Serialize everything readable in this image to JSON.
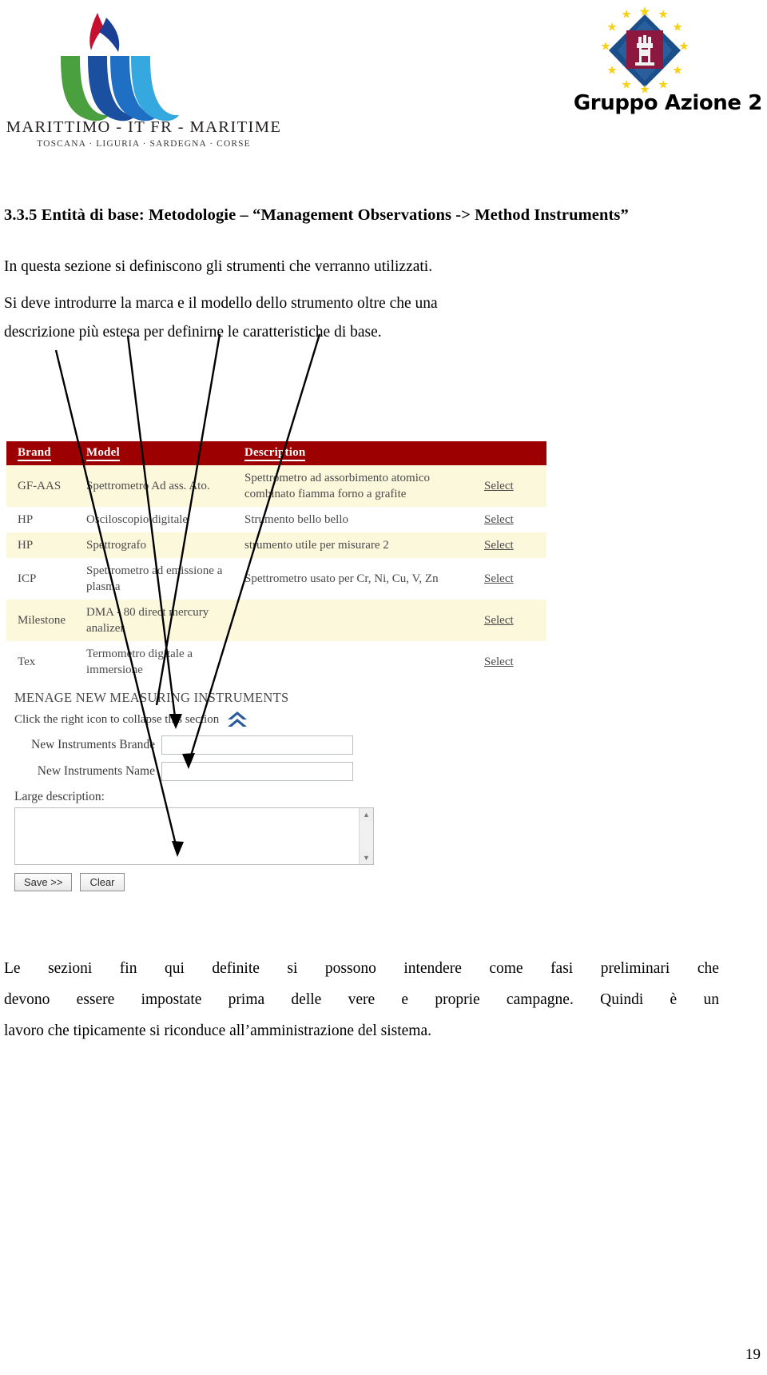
{
  "header": {
    "left_logo": {
      "wordmark": "MARITTIMO - IT FR - MARITIME",
      "subwordmark": "TOSCANA · LIGURIA · SARDEGNA · CORSE"
    },
    "right_logo": {
      "title": "Gruppo Azione 2"
    }
  },
  "document": {
    "section_number": "3.3.5",
    "heading": "3.3.5 Entità di base: Metodologie – “Management Observations -> Method Instruments”",
    "paragraph_1": "In questa sezione si definiscono gli strumenti che verranno utilizzati.",
    "paragraph_2_line_1": [
      "Si",
      "deve",
      "introdurre",
      "la",
      "marca",
      "e",
      "il",
      "modello",
      "dello",
      "strumento",
      "oltre",
      "che",
      "una"
    ],
    "paragraph_2_line_2": "descrizione più estesa per definirne le caratteristiche di base.",
    "paragraph_3_line_1": [
      "Le",
      "sezioni",
      "fin",
      "qui",
      "definite",
      "si",
      "possono",
      "intendere",
      "come",
      "fasi",
      "preliminari",
      "che"
    ],
    "paragraph_3_line_2": [
      "devono",
      "essere",
      "impostate",
      "prima",
      "delle",
      "vere",
      "e",
      "proprie",
      "campagne.",
      "Quindi",
      "è",
      "un"
    ],
    "paragraph_3_line_3": "lavoro che tipicamente si riconduce all’amministrazione del sistema.",
    "page_number": "19"
  },
  "screenshot": {
    "table": {
      "columns": [
        "Brand",
        "Model",
        "Description"
      ],
      "action_label": "Select",
      "rows": [
        {
          "brand": "GF-AAS",
          "model": "Spettrometro Ad ass. Ato.",
          "description": "Spettrometro ad assorbimento atomico combinato fiamma forno a grafite",
          "action": "Select"
        },
        {
          "brand": "HP",
          "model": "Osciloscopio digitale",
          "description": "Strumento bello bello",
          "action": "Select"
        },
        {
          "brand": "HP",
          "model": "Spettrografo",
          "description": "strumento utile per misurare 2",
          "action": "Select"
        },
        {
          "brand": "ICP",
          "model": "Spettrometro ad emissione a plasma",
          "description": "Spettrometro usato per Cr, Ni, Cu, V, Zn",
          "action": "Select"
        },
        {
          "brand": "Milestone",
          "model": "DMA - 80 direct mercury analizer",
          "description": "",
          "action": "Select"
        },
        {
          "brand": "Tex",
          "model": "Termometro digitale a immersione",
          "description": "",
          "action": "Select"
        }
      ]
    },
    "form": {
      "title": "MENAGE NEW MEASURING INSTRUMENTS",
      "collapse_hint": "Click the right icon to collapse this section",
      "collapse_icon": "double-chevron-up-icon",
      "brand_label": "New Instruments Brande",
      "brand_value": "",
      "name_label": "New Instruments Name",
      "name_value": "",
      "description_label": "Large description:",
      "description_value": "",
      "save_label": "Save >>",
      "clear_label": "Clear"
    },
    "colors": {
      "header_bg": "#9c0000",
      "row_alt_bg": "#fcf8dc",
      "row_bg": "#ffffff",
      "collapse_icon": "#2c5aa0"
    }
  }
}
